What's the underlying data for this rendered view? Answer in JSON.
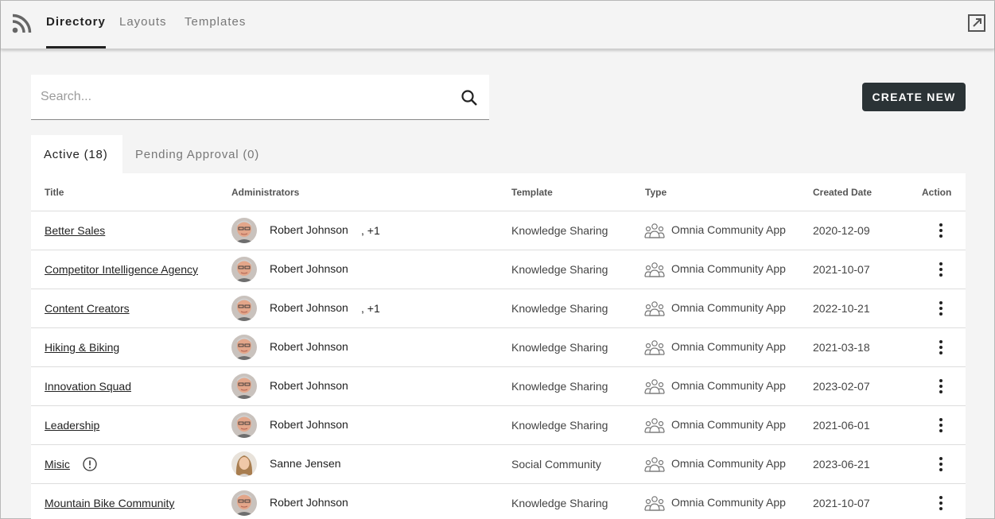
{
  "nav": {
    "feed_icon": "rss-icon",
    "tabs": [
      {
        "label": "Directory",
        "active": true
      },
      {
        "label": "Layouts",
        "active": false
      },
      {
        "label": "Templates",
        "active": false
      }
    ],
    "popout_icon": "open-in-new-icon"
  },
  "search": {
    "placeholder": "Search...",
    "value": ""
  },
  "create_button": {
    "label": "CREATE NEW"
  },
  "content_tabs": [
    {
      "label": "Active (18)",
      "active": true
    },
    {
      "label": "Pending Approval (0)",
      "active": false
    }
  ],
  "table": {
    "headers": {
      "title": "Title",
      "administrators": "Administrators",
      "template": "Template",
      "type": "Type",
      "created": "Created Date",
      "action": "Action"
    },
    "rows": [
      {
        "title": "Better Sales",
        "admin": "Robert Johnson",
        "extra": ", +1",
        "template": "Knowledge Sharing",
        "type": "Omnia Community App",
        "date": "2020-12-09",
        "avatar": "male",
        "warning": false
      },
      {
        "title": "Competitor Intelligence Agency",
        "admin": "Robert Johnson",
        "extra": "",
        "template": "Knowledge Sharing",
        "type": "Omnia Community App",
        "date": "2021-10-07",
        "avatar": "male",
        "warning": false
      },
      {
        "title": "Content Creators",
        "admin": "Robert Johnson",
        "extra": ", +1",
        "template": "Knowledge Sharing",
        "type": "Omnia Community App",
        "date": "2022-10-21",
        "avatar": "male",
        "warning": false
      },
      {
        "title": "Hiking & Biking",
        "admin": "Robert Johnson",
        "extra": "",
        "template": "Knowledge Sharing",
        "type": "Omnia Community App",
        "date": "2021-03-18",
        "avatar": "male",
        "warning": false
      },
      {
        "title": "Innovation Squad",
        "admin": "Robert Johnson",
        "extra": "",
        "template": "Knowledge Sharing",
        "type": "Omnia Community App",
        "date": "2023-02-07",
        "avatar": "male",
        "warning": false
      },
      {
        "title": "Leadership",
        "admin": "Robert Johnson",
        "extra": "",
        "template": "Knowledge Sharing",
        "type": "Omnia Community App",
        "date": "2021-06-01",
        "avatar": "male",
        "warning": false
      },
      {
        "title": "Misic",
        "admin": "Sanne Jensen",
        "extra": "",
        "template": "Social Community",
        "type": "Omnia Community App",
        "date": "2023-06-21",
        "avatar": "female",
        "warning": true
      },
      {
        "title": "Mountain Bike Community",
        "admin": "Robert Johnson",
        "extra": "",
        "template": "Knowledge Sharing",
        "type": "Omnia Community App",
        "date": "2021-10-07",
        "avatar": "male",
        "warning": false
      }
    ]
  }
}
